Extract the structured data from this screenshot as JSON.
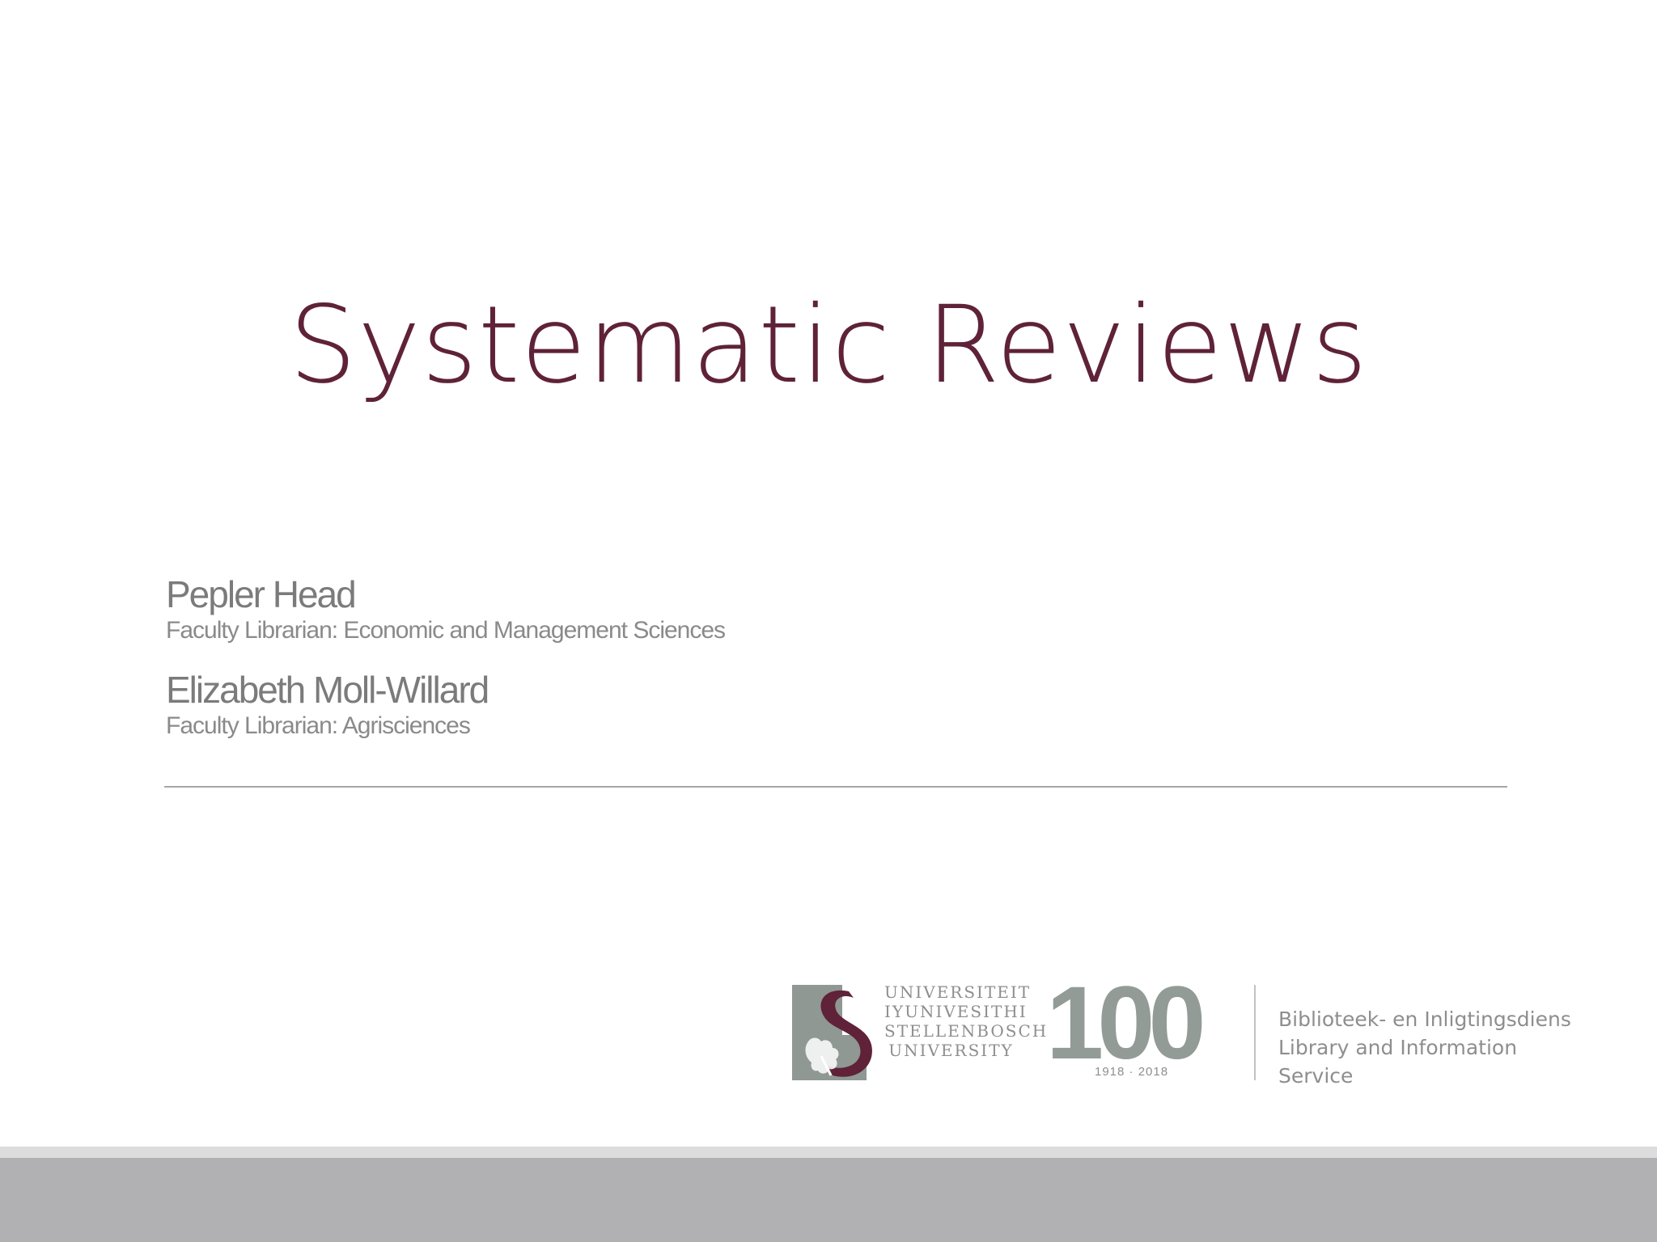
{
  "slide": {
    "title": "Systematic Reviews",
    "presenters": [
      {
        "name": "Pepler Head",
        "role": "Faculty Librarian: Economic and Management Sciences"
      },
      {
        "name": "Elizabeth Moll-Willard",
        "role": "Faculty Librarian: Agrisciences"
      }
    ]
  },
  "logo": {
    "university_lines": [
      "UNIVERSITEIT",
      "IYUNIVESITHI",
      "STELLENBOSCH",
      "UNIVERSITY"
    ],
    "centenary_number": "100",
    "centenary_years": "1918 · 2018",
    "service_lines": [
      "Biblioteek- en Inligtingsdiens",
      "Library and Information Service"
    ],
    "crest_icon": "stellenbosch-crest-icon"
  },
  "colors": {
    "title": "#5f2238",
    "crest_maroon": "#5f2238",
    "crest_grey": "#8f9893",
    "text_grey": "#7b7b7b",
    "footer": "#b1b0b2"
  }
}
